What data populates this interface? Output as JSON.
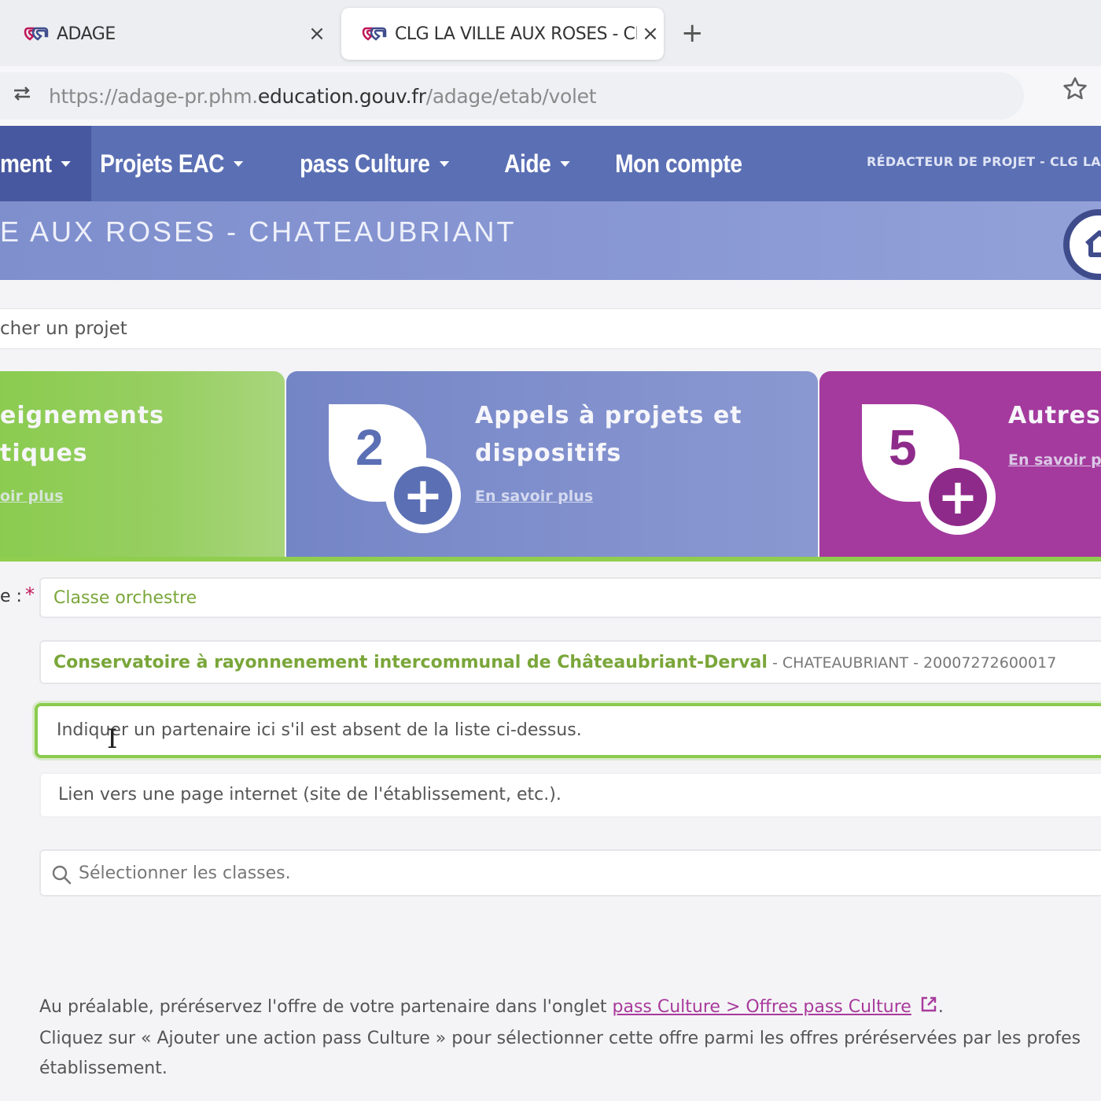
{
  "browser": {
    "tabs": [
      {
        "title": "ADAGE",
        "close": "×"
      },
      {
        "title": "CLG LA VILLE AUX ROSES - CH",
        "close": "×"
      }
    ],
    "new_tab": "+",
    "url_prefix": "https://adage-pr.phm.",
    "url_domain": "education.gouv.fr",
    "url_path": "/adage/etab/volet"
  },
  "nav": {
    "items": [
      {
        "label": "ment"
      },
      {
        "label": "Projets EAC"
      },
      {
        "label": "pass Culture"
      },
      {
        "label": "Aide"
      },
      {
        "label": "Mon compte"
      }
    ],
    "role": "RÉDACTEUR DE PROJET - CLG LA"
  },
  "etab": {
    "title": "E AUX ROSES - CHATEAUBRIANT"
  },
  "search": {
    "placeholder": "cher un projet"
  },
  "cards": [
    {
      "title_line1": "eignements",
      "title_line2": "tiques",
      "link": "oir plus",
      "color": "#8acb4e"
    },
    {
      "number": "2",
      "title_line1": "Appels à projets et",
      "title_line2": "dispositifs",
      "link": "En savoir plus",
      "color": "#7485c6"
    },
    {
      "number": "5",
      "title_line1": "Autres",
      "link": "En savoir p",
      "color": "#a43a9e"
    }
  ],
  "form": {
    "label_fragment": "e :",
    "required_mark": "*",
    "name_value": "Classe orchestre",
    "partner_name": "Conservatoire à rayonnenement intercommunal de Châteaubriant-Derval",
    "partner_details": " - CHATEAUBRIANT - 20007272600017",
    "other_partner_placeholder": "Indiquer un partenaire ici s'il est absent de la liste ci-dessus.",
    "website_placeholder": "Lien vers une page internet (site de l'établissement, etc.).",
    "classes_placeholder": "Sélectionner les classes."
  },
  "info": {
    "line1_before": "Au préalable, préréservez l'offre de votre partenaire dans l'onglet ",
    "line1_link": "pass Culture > Offres pass Culture",
    "line1_after": ".",
    "line2": "Cliquez sur « Ajouter une action pass Culture » pour sélectionner cette offre parmi les offres préréservées par les profes",
    "line3": "établissement."
  },
  "colors": {
    "nav": "#5b6fb4",
    "green": "#8acb4e",
    "blue": "#7485c6",
    "purple": "#a43a9e"
  }
}
